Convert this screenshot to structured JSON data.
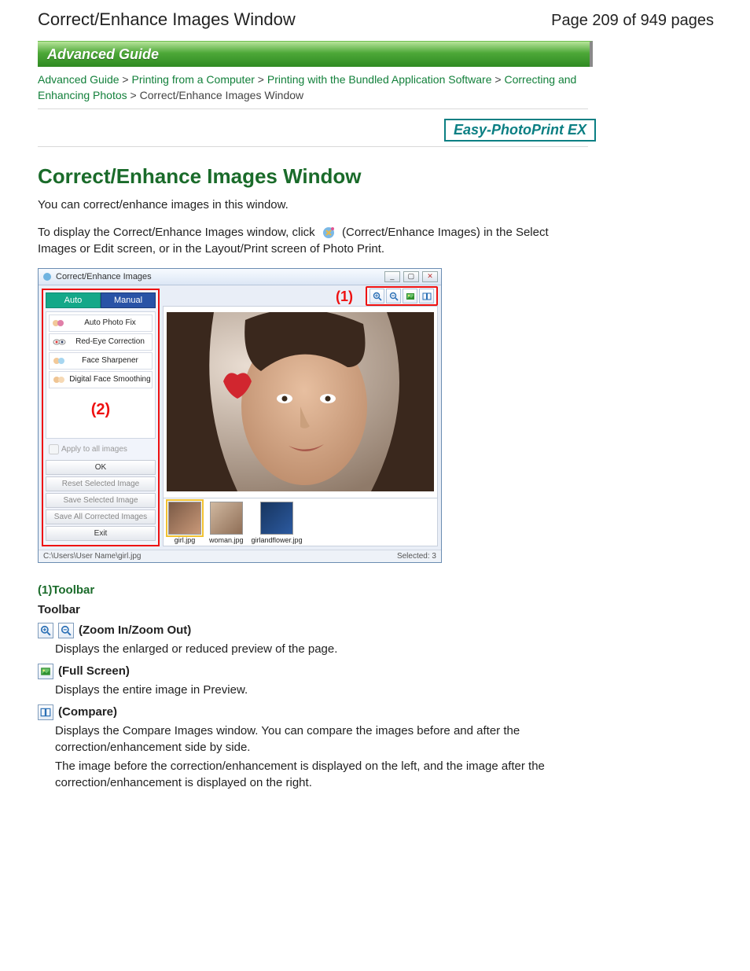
{
  "header": {
    "title": "Correct/Enhance Images Window",
    "page_label": "Page 209 of 949 pages"
  },
  "green_bar": "Advanced Guide",
  "breadcrumb": {
    "items": [
      "Advanced Guide",
      "Printing from a Computer",
      "Printing with the Bundled Application Software",
      "Correcting and Enhancing Photos"
    ],
    "current": "Correct/Enhance Images Window",
    "sep": ">"
  },
  "badge": "Easy-PhotoPrint EX",
  "page_title": "Correct/Enhance Images Window",
  "intro1": "You can correct/enhance images in this window.",
  "intro2a": "To display the Correct/Enhance Images window, click",
  "intro2b": "(Correct/Enhance Images) in the Select Images or Edit screen, or in the Layout/Print screen of Photo Print.",
  "app": {
    "title": "Correct/Enhance Images",
    "tabs": {
      "auto": "Auto",
      "manual": "Manual"
    },
    "options": [
      "Auto Photo Fix",
      "Red-Eye Correction",
      "Face Sharpener",
      "Digital Face Smoothing"
    ],
    "annot1": "(1)",
    "annot2": "(2)",
    "apply_all": "Apply to all images",
    "ok": "OK",
    "buttons": [
      "Reset Selected Image",
      "Save Selected Image",
      "Save All Corrected Images"
    ],
    "exit": "Exit",
    "thumbs": [
      "girl.jpg",
      "woman.jpg",
      "girlandflower.jpg"
    ],
    "status_path": "C:\\Users\\User Name\\girl.jpg",
    "status_sel": "Selected: 3"
  },
  "section1": {
    "heading": "(1)Toolbar",
    "subheading": "Toolbar",
    "items": [
      {
        "title": "(Zoom In/Zoom Out)",
        "body": [
          "Displays the enlarged or reduced preview of the page."
        ]
      },
      {
        "title": "(Full Screen)",
        "body": [
          "Displays the entire image in Preview."
        ]
      },
      {
        "title": "(Compare)",
        "body": [
          "Displays the Compare Images window. You can compare the images before and after the correction/enhancement side by side.",
          "The image before the correction/enhancement is displayed on the left, and the image after the correction/enhancement is displayed on the right."
        ]
      }
    ]
  }
}
